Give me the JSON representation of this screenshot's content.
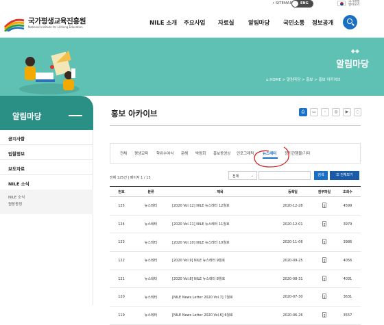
{
  "header": {
    "logo_ko": "국가평생교육진흥원",
    "logo_en": "National Institute for Lifelong Education",
    "sitemap": "• SITEMAP",
    "lang": "ENG",
    "lang_link": "국가평생 열어보기",
    "nav": [
      "NILE 소개",
      "주요사업",
      "자료실",
      "알림마당",
      "국민소통",
      "정보공개"
    ],
    "accent": "#1a6fc4"
  },
  "hero": {
    "title": "알림마당",
    "breadcrumb": "⌂ HOME  >  알림마당  >  홍보  >  홍보 아카이브",
    "color": "#5fc1b4"
  },
  "sidebar": {
    "title": "알림마당",
    "items": [
      "공지사항",
      "입찰정보",
      "보도자료",
      "NILE 소식"
    ],
    "sub_items": [
      "NILE 소식",
      "원장동정"
    ],
    "color": "#2a8f84"
  },
  "main": {
    "title": "홍보 아카이브",
    "share_icons": [
      "print-icon",
      "facebook-icon",
      "twitter-icon",
      "instagram-icon",
      "youtube-icon",
      "blog-icon",
      "link-icon"
    ],
    "tabs": [
      "전체",
      "평생교육",
      "학위수여식",
      "문해",
      "박람회",
      "홍보동영상",
      "인포그래픽",
      "뉴스레터",
      "정기간행물/기타"
    ],
    "active_tab": "뉴스레터",
    "count_text": "전체 125건 | 페이지 1 / 13",
    "search": {
      "select": "전체",
      "button": "검색",
      "all_button": "☰ 전체보기"
    },
    "columns": [
      "번호",
      "분류",
      "제목",
      "등록일",
      "첨부파일",
      "조회수"
    ],
    "rows": [
      {
        "no": "125",
        "cat": "뉴스레터",
        "title": "[2020 Vol.12] NILE 뉴스레터 12월호",
        "date": "2020-12-28",
        "views": "4599"
      },
      {
        "no": "124",
        "cat": "뉴스레터",
        "title": "[2020 Vol.11] NILE 뉴스레터 11월호",
        "date": "2020-12-01",
        "views": "3979"
      },
      {
        "no": "123",
        "cat": "뉴스레터",
        "title": "[2020 Vol.10] NILE 뉴스레터 10월호",
        "date": "2020-11-06",
        "views": "3986"
      },
      {
        "no": "122",
        "cat": "뉴스레터",
        "title": "[2020 Vol.9] NILE 뉴스레터 9월호",
        "date": "2020-09-25",
        "views": "4056"
      },
      {
        "no": "121",
        "cat": "뉴스레터",
        "title": "[2020 Vol.8] NILE 뉴스레터 8월호",
        "date": "2020-08-31",
        "views": "4031"
      },
      {
        "no": "120",
        "cat": "뉴스레터",
        "title": "[NILE News Letter 2020 Vol.7] 7월호",
        "date": "2020-07-30",
        "views": "3631"
      },
      {
        "no": "119",
        "cat": "뉴스레터",
        "title": "[NILE News Letter 2020 Vol.6] 6월호",
        "date": "2020-06-26",
        "views": "3557"
      }
    ]
  }
}
